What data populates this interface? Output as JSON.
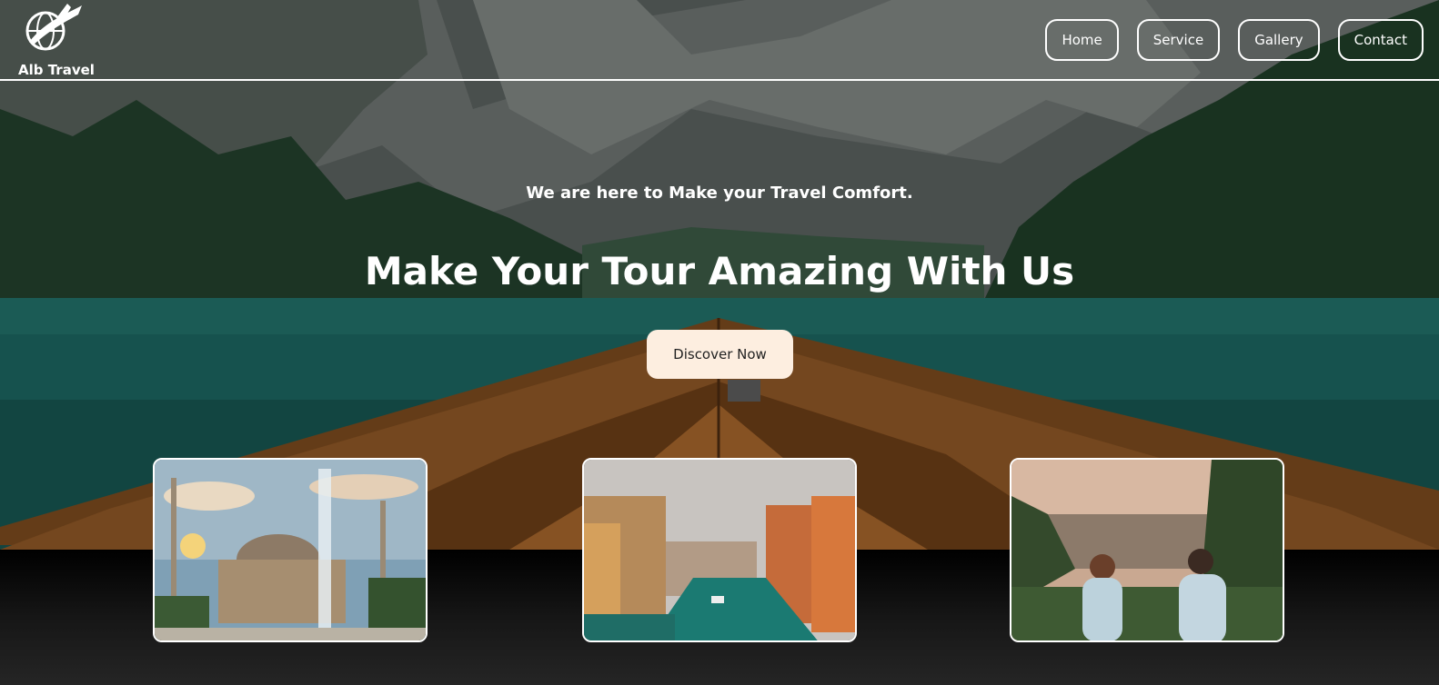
{
  "brand": {
    "name": "Alb Travel",
    "logo_icon": "plane-globe-icon"
  },
  "nav": {
    "items": [
      {
        "label": "Home"
      },
      {
        "label": "Service"
      },
      {
        "label": "Gallery"
      },
      {
        "label": "Contact"
      }
    ]
  },
  "hero": {
    "tagline": "We are here to Make your Travel Comfort.",
    "headline": "Make Your Tour Amazing With Us",
    "cta_label": "Discover Now",
    "background_image": "mountain-lake-boat-photo"
  },
  "gallery": {
    "cards": [
      {
        "image": "mosque-fountain-photo"
      },
      {
        "image": "canal-city-photo"
      },
      {
        "image": "couple-overlooking-city-photo"
      }
    ]
  },
  "colors": {
    "cta_background": "#fdeee0",
    "nav_border": "#ffffff",
    "text": "#ffffff"
  }
}
